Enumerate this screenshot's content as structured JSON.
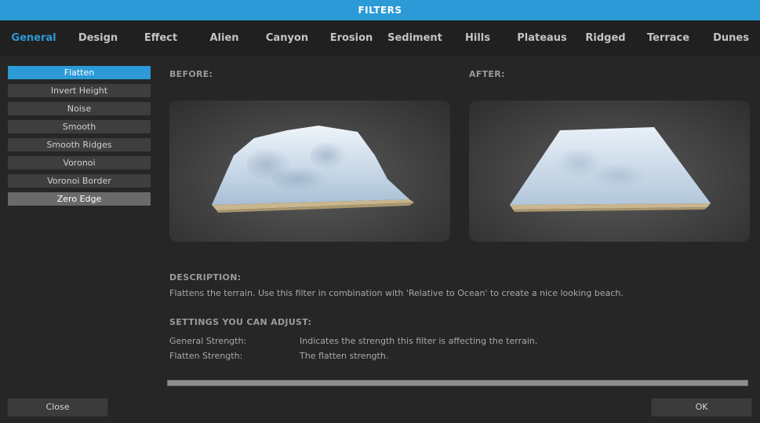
{
  "window": {
    "title": "FILTERS"
  },
  "tabs": [
    {
      "label": "General",
      "active": true
    },
    {
      "label": "Design"
    },
    {
      "label": "Effect"
    },
    {
      "label": "Alien"
    },
    {
      "label": "Canyon"
    },
    {
      "label": "Erosion"
    },
    {
      "label": "Sediment"
    },
    {
      "label": "Hills"
    },
    {
      "label": "Plateaus"
    },
    {
      "label": "Ridged"
    },
    {
      "label": "Terrace"
    },
    {
      "label": "Dunes"
    }
  ],
  "filters": [
    {
      "label": "Flatten",
      "state": "selected"
    },
    {
      "label": "Invert Height"
    },
    {
      "label": "Noise"
    },
    {
      "label": "Smooth"
    },
    {
      "label": "Smooth Ridges"
    },
    {
      "label": "Voronoi"
    },
    {
      "label": "Voronoi Border"
    },
    {
      "label": "Zero Edge",
      "state": "hover"
    }
  ],
  "preview": {
    "before_label": "BEFORE:",
    "after_label": "AFTER:"
  },
  "description": {
    "heading": "DESCRIPTION:",
    "text": "Flattens the terrain. Use this filter in combination with 'Relative to Ocean' to create a nice looking beach."
  },
  "settings": {
    "heading": "SETTINGS YOU CAN ADJUST:",
    "items": [
      {
        "name": "General Strength:",
        "desc": "Indicates the strength this filter is affecting the terrain."
      },
      {
        "name": "Flatten Strength:",
        "desc": "The flatten strength."
      }
    ]
  },
  "buttons": {
    "close": "Close",
    "ok": "OK"
  },
  "colors": {
    "accent": "#2b9ad6",
    "background": "#262626",
    "button": "#3b3b3b"
  }
}
